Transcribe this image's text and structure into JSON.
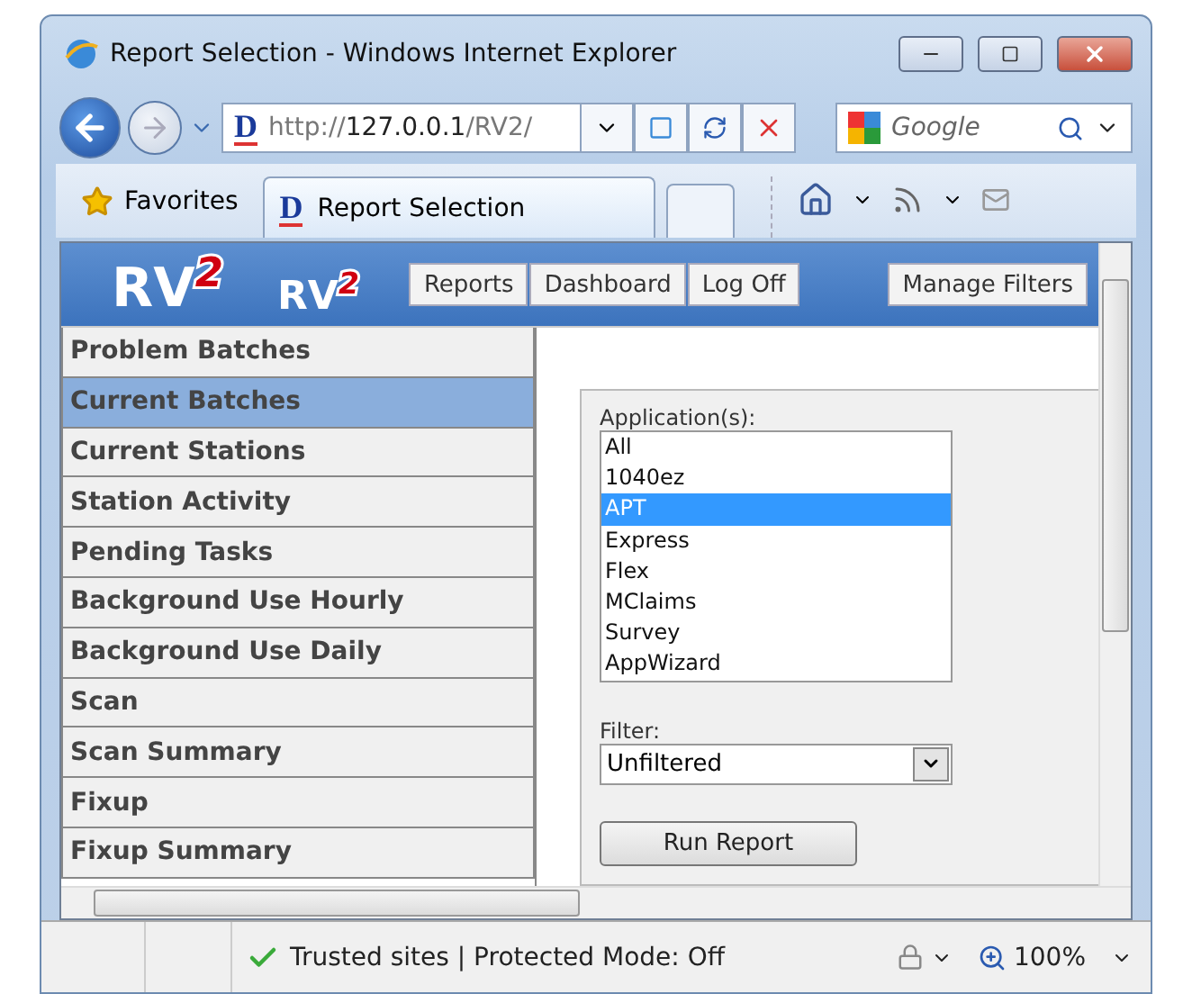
{
  "window": {
    "title": "Report Selection - Windows Internet Explorer"
  },
  "address_bar": {
    "site_icon": "D",
    "scheme": "http://",
    "host": "127.0.0.1",
    "path": "/RV2/"
  },
  "search": {
    "placeholder": "Google"
  },
  "favorites": {
    "label": "Favorites"
  },
  "tabs": [
    {
      "icon": "D",
      "label": "Report Selection",
      "selected": true
    }
  ],
  "page": {
    "logos": [
      "RV$^{2}$",
      "RV$^{2}$"
    ],
    "nav_buttons": [
      "Reports",
      "Dashboard",
      "Log Off"
    ],
    "manage_button": "Manage Filters",
    "menu": [
      {
        "label": "Problem Batches",
        "selected": false
      },
      {
        "label": "Current Batches",
        "selected": true
      },
      {
        "label": "Current Stations",
        "selected": false
      },
      {
        "label": "Station Activity",
        "selected": false
      },
      {
        "label": "Pending Tasks",
        "selected": false
      },
      {
        "label": "Background Use Hourly",
        "selected": false
      },
      {
        "label": "Background Use Daily",
        "selected": false
      },
      {
        "label": "Scan",
        "selected": false
      },
      {
        "label": "Scan Summary",
        "selected": false
      },
      {
        "label": "Fixup",
        "selected": false
      },
      {
        "label": "Fixup Summary",
        "selected": false
      }
    ],
    "applications": {
      "label": "Application(s):",
      "options": [
        {
          "label": "All",
          "selected": false
        },
        {
          "label": "1040ez",
          "selected": false
        },
        {
          "label": "APT",
          "selected": true
        },
        {
          "label": "Express",
          "selected": false
        },
        {
          "label": "Flex",
          "selected": false
        },
        {
          "label": "MClaims",
          "selected": false
        },
        {
          "label": "Survey",
          "selected": false
        },
        {
          "label": "AppWizard",
          "selected": false
        }
      ]
    },
    "filter": {
      "label": "Filter:",
      "value": "Unfiltered"
    },
    "run_button": "Run Report"
  },
  "status_bar": {
    "zone": "Trusted sites | Protected Mode: Off",
    "zoom": "100%"
  }
}
